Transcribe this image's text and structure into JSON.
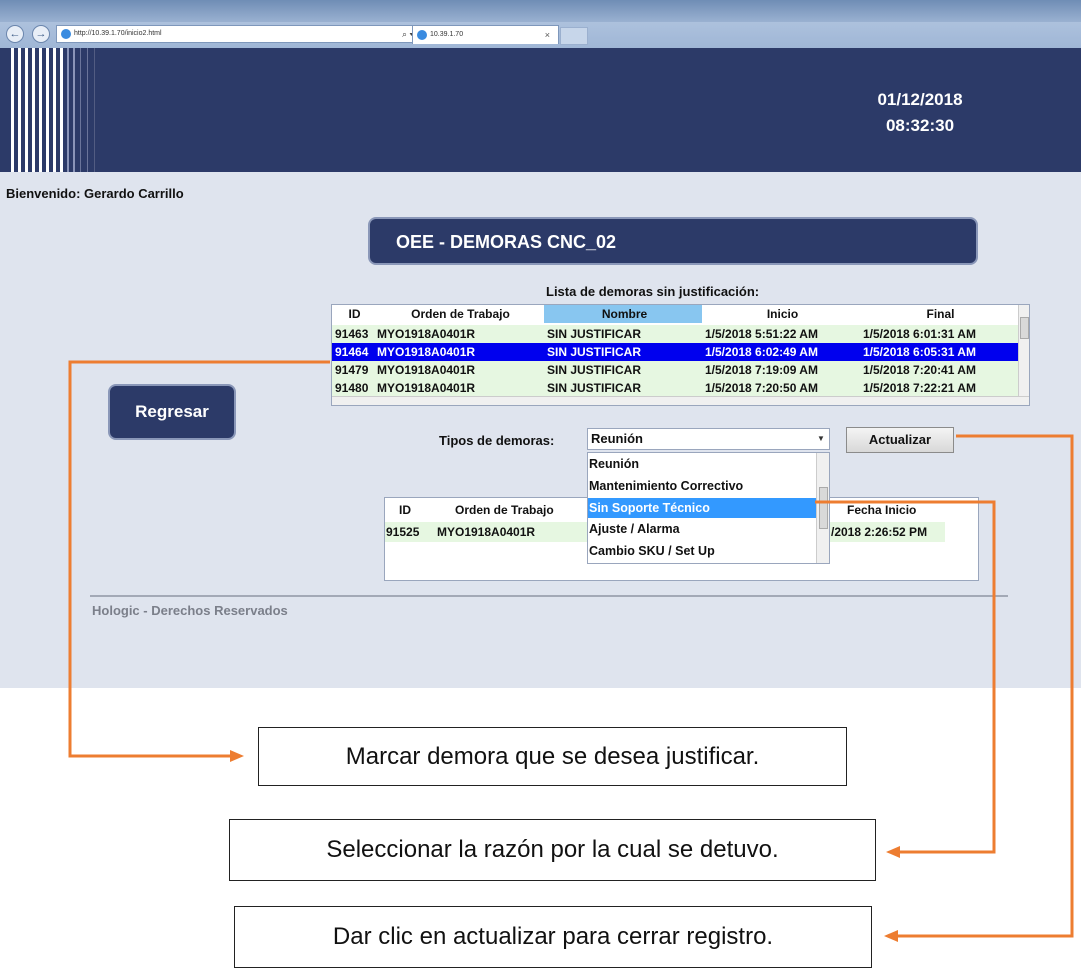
{
  "browser": {
    "address": "http://10.39.1.70/inicio2.html",
    "address_controls": "⌕ ▾ ↻",
    "tab_title": "10.39.1.70",
    "tab_close": "×",
    "back": "←",
    "forward": "→"
  },
  "header": {
    "date": "01/12/2018",
    "time": "08:32:30"
  },
  "welcome": "Bienvenido: Gerardo Carrillo",
  "page_title": "OEE - DEMORAS CNC_02",
  "back_button": "Regresar",
  "list_caption": "Lista de demoras sin justificación:",
  "delays_table": {
    "columns": [
      "ID",
      "Orden de Trabajo",
      "Nombre",
      "Inicio",
      "Final"
    ],
    "rows": [
      [
        "91463",
        "MYO1918A0401R",
        "SIN JUSTIFICAR",
        "1/5/2018 5:51:22 AM",
        "1/5/2018 6:01:31 AM"
      ],
      [
        "91464",
        "MYO1918A0401R",
        "SIN JUSTIFICAR",
        "1/5/2018 6:02:49 AM",
        "1/5/2018 6:05:31 AM"
      ],
      [
        "91479",
        "MYO1918A0401R",
        "SIN JUSTIFICAR",
        "1/5/2018 7:19:09 AM",
        "1/5/2018 7:20:41 AM"
      ],
      [
        "91480",
        "MYO1918A0401R",
        "SIN JUSTIFICAR",
        "1/5/2018 7:20:50 AM",
        "1/5/2018 7:22:21 AM"
      ]
    ],
    "selected_row": 1
  },
  "tipos": {
    "label": "Tipos de demoras:",
    "selected": "Reunión",
    "options": [
      "Reunión",
      "Mantenimiento Correctivo",
      "Sin Soporte Técnico",
      "Ajuste / Alarma",
      "Cambio SKU / Set Up"
    ],
    "highlighted": 2
  },
  "update_button": "Actualizar",
  "justified_table": {
    "columns": [
      "ID",
      "Orden de Trabajo",
      "Fecha Inicio"
    ],
    "rows": [
      [
        "91525",
        "MYO1918A0401R",
        "/2018 2:26:52 PM"
      ]
    ]
  },
  "footer": "Hologic - Derechos Reservados",
  "annotations": [
    "Marcar demora que se desea justificar.",
    "Seleccionar la razón por la cual se detuvo.",
    "Dar clic en actualizar para cerrar registro."
  ],
  "colors": {
    "header_bg": "#2c3a68",
    "body_bg": "#dfe4ee",
    "selected_row": "#0000ee",
    "data_row": "#e6f7e1",
    "highlight": "#3399ff",
    "arrow": "#ed7d31"
  }
}
